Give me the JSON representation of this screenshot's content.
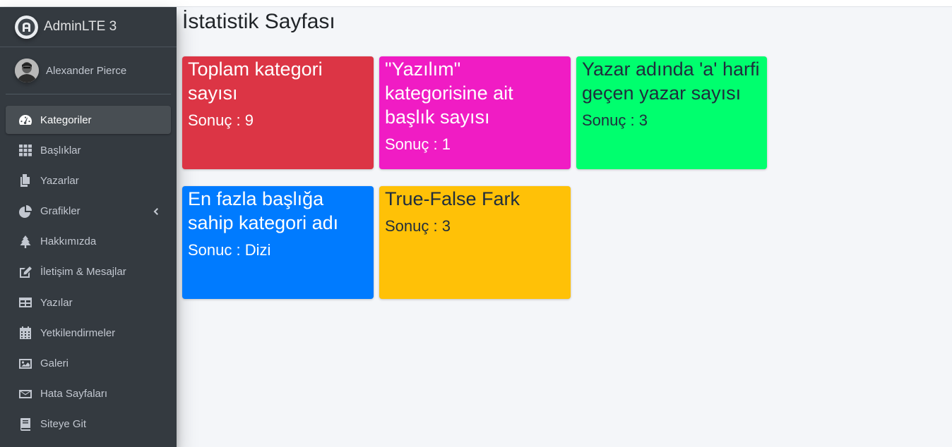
{
  "brand": {
    "name": "AdminLTE 3"
  },
  "user": {
    "name": "Alexander Pierce"
  },
  "sidebar": {
    "items": [
      {
        "label": "Kategoriler",
        "icon": "tachometer-icon",
        "active": true
      },
      {
        "label": "Başlıklar",
        "icon": "th-icon"
      },
      {
        "label": "Yazarlar",
        "icon": "copy-icon"
      },
      {
        "label": "Grafikler",
        "icon": "chart-pie-icon",
        "has_submenu": true
      },
      {
        "label": "Hakkımızda",
        "icon": "tree-icon"
      },
      {
        "label": "İletişim & Mesajlar",
        "icon": "edit-icon"
      },
      {
        "label": "Yazılar",
        "icon": "table-icon"
      },
      {
        "label": "Yetkilendirmeler",
        "icon": "calendar-icon"
      },
      {
        "label": "Galeri",
        "icon": "image-icon"
      },
      {
        "label": "Hata Sayfaları",
        "icon": "envelope-icon"
      },
      {
        "label": "Siteye Git",
        "icon": "book-icon"
      }
    ]
  },
  "page": {
    "title": "İstatistik Sayfası"
  },
  "stats": [
    {
      "title": "Toplam kategori sayısı",
      "result": "Sonuç : 9",
      "color": "#dc3545"
    },
    {
      "title": "\"Yazılım\" kategorisine ait başlık sayısı",
      "result": "Sonuç : 1",
      "color": "#f01cc4"
    },
    {
      "title": "Yazar adında 'a' harfi geçen yazar sayısı",
      "result": "Sonuç : 3",
      "color": "#00ff6e"
    },
    {
      "title": "En fazla başlığa sahip kategori adı",
      "result": "Sonuc : Dizi",
      "color": "#007bff"
    },
    {
      "title": "True-False Fark",
      "result": "Sonuç : 3",
      "color": "#ffc107"
    }
  ]
}
